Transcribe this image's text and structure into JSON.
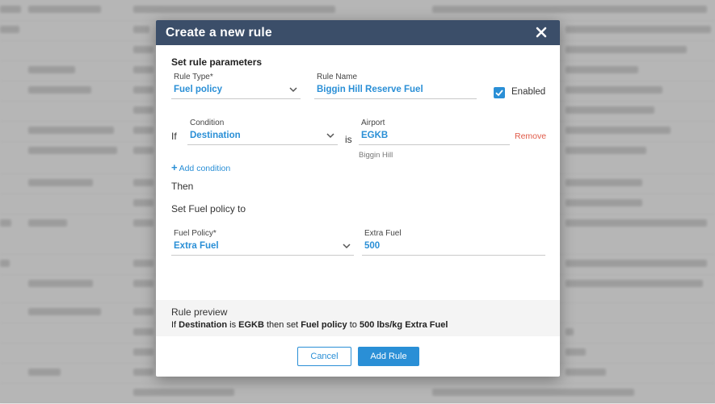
{
  "modal": {
    "title": "Create a new rule",
    "section_title": "Set rule parameters"
  },
  "rule_type": {
    "label": "Rule Type*",
    "value": "Fuel policy"
  },
  "rule_name": {
    "label": "Rule Name",
    "value": "Biggin Hill Reserve Fuel"
  },
  "enabled": {
    "label": "Enabled",
    "checked": true
  },
  "condition_row": {
    "if_label": "If",
    "condition": {
      "label": "Condition",
      "value": "Destination"
    },
    "is_label": "is",
    "airport": {
      "label": "Airport",
      "value": "EGKB",
      "hint": "Biggin Hill"
    },
    "remove_label": "Remove"
  },
  "add_condition_label": "Add condition",
  "then_label": "Then",
  "set_label": "Set Fuel policy to",
  "fuel_policy": {
    "label": "Fuel Policy*",
    "value": "Extra Fuel"
  },
  "extra_fuel": {
    "label": "Extra Fuel",
    "value": "500"
  },
  "preview": {
    "title": "Rule preview",
    "parts": {
      "p1": "If ",
      "b1": "Destination",
      "p2": " is ",
      "b2": "EGKB",
      "p3": " then set ",
      "b3": "Fuel policy",
      "p4": " to ",
      "b4": "500 lbs/kg Extra Fuel"
    }
  },
  "buttons": {
    "cancel": "Cancel",
    "add": "Add Rule"
  },
  "colors": {
    "header": "#3b4e69",
    "accent": "#2a8fd6",
    "danger": "#e05a48"
  }
}
